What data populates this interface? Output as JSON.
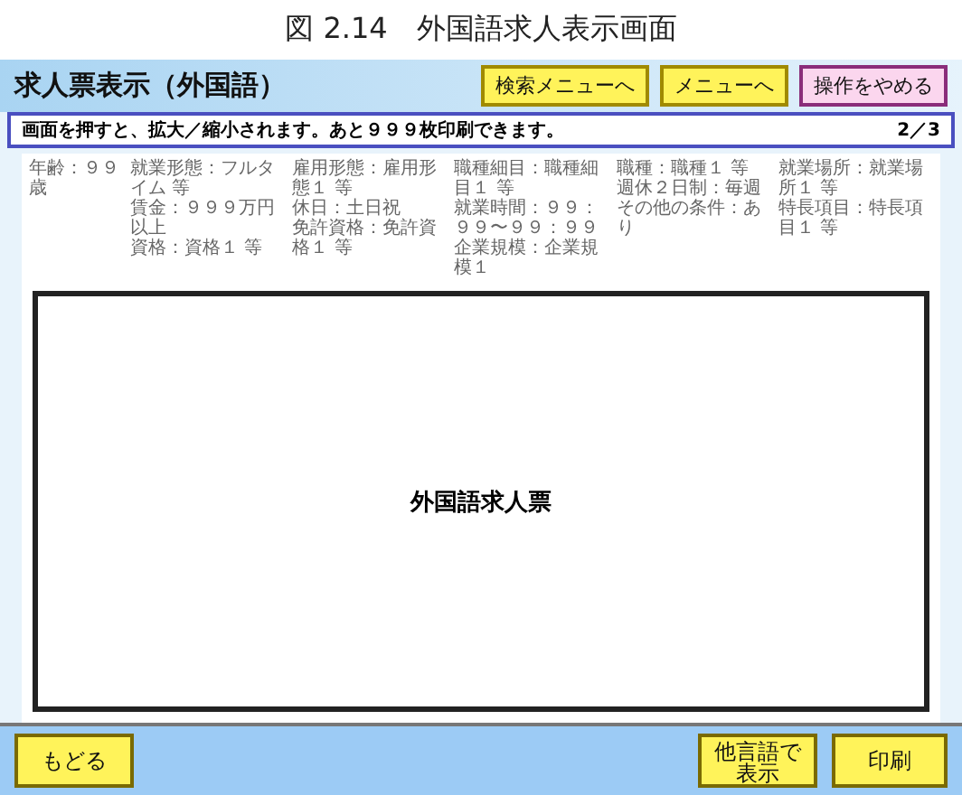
{
  "caption": "図 2.14　外国語求人表示画面",
  "header": {
    "title": "求人票表示（外国語）",
    "buttons": [
      {
        "label": "検索メニューへ",
        "kind": "nav"
      },
      {
        "label": "メニューへ",
        "kind": "nav"
      },
      {
        "label": "操作をやめる",
        "kind": "quit"
      }
    ]
  },
  "info_bar": {
    "message": "画面を押すと、拡大／縮小されます。あと９９９枚印刷できます。",
    "page": "2／3"
  },
  "summary": [
    [
      "年齢：９９歳"
    ],
    [
      "就業形態：フルタイム 等",
      "賃金：９９９万円以上",
      "資格：資格１ 等"
    ],
    [
      "雇用形態：雇用形態１ 等",
      "休日：土日祝",
      "免許資格：免許資格１ 等"
    ],
    [
      "職種細目：職種細目１ 等",
      "就業時間：９９：９９〜９９：９９",
      "企業規模：企業規模１"
    ],
    [
      "職種：職種１ 等",
      "週休２日制：毎週",
      "その他の条件：あり"
    ],
    [
      "就業場所：就業場所１ 等",
      "特長項目：特長項目１ 等"
    ]
  ],
  "document": {
    "label": "外国語求人票"
  },
  "footer": {
    "buttons": [
      {
        "label": "もどる",
        "kind": "left"
      },
      {
        "label": "他言語で表示",
        "kind": "right"
      },
      {
        "label": "印刷",
        "kind": "right"
      }
    ]
  }
}
